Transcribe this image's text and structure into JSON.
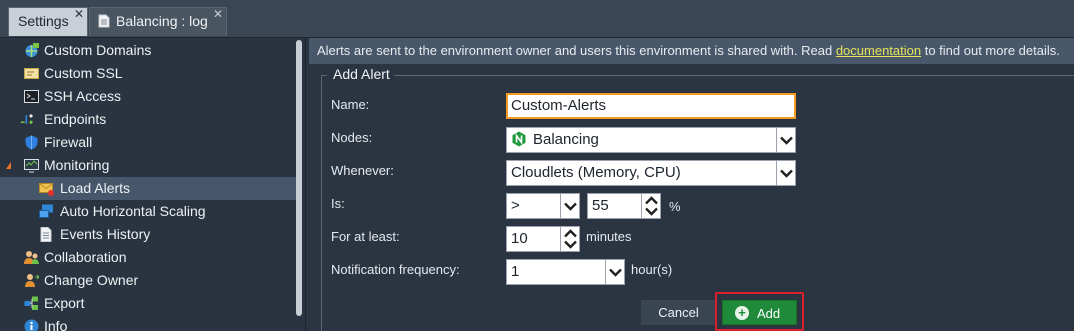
{
  "tabs": [
    {
      "label": "Settings",
      "close": "✕"
    },
    {
      "label": "Balancing : log",
      "close": "✕"
    }
  ],
  "sidebar": {
    "items": [
      {
        "label": "Custom Domains",
        "icon": "globe-icon"
      },
      {
        "label": "Custom SSL",
        "icon": "certificate-icon"
      },
      {
        "label": "SSH Access",
        "icon": "terminal-icon"
      },
      {
        "label": "Endpoints",
        "icon": "endpoints-icon"
      },
      {
        "label": "Firewall",
        "icon": "shield-icon"
      },
      {
        "label": "Monitoring",
        "icon": "monitor-icon",
        "expanded": true
      },
      {
        "label": "Load Alerts",
        "icon": "mail-alert-icon",
        "selected": true
      },
      {
        "label": "Auto Horizontal Scaling",
        "icon": "scaling-icon"
      },
      {
        "label": "Events History",
        "icon": "document-icon"
      },
      {
        "label": "Collaboration",
        "icon": "users-icon"
      },
      {
        "label": "Change Owner",
        "icon": "user-change-icon"
      },
      {
        "label": "Export",
        "icon": "export-icon"
      },
      {
        "label": "Info",
        "icon": "info-icon"
      }
    ]
  },
  "info_bar": {
    "text_before": "Alerts are sent to the environment owner and users this environment is shared with. Read ",
    "link": "documentation",
    "text_after": " to find out more details."
  },
  "form": {
    "legend": "Add Alert",
    "name_label": "Name:",
    "name_value": "Custom-Alerts",
    "nodes_label": "Nodes:",
    "nodes_value": "Balancing",
    "whenever_label": "Whenever:",
    "whenever_value": "Cloudlets (Memory, CPU)",
    "is_label": "Is:",
    "is_operator": ">",
    "is_value": "55",
    "is_unit": "%",
    "for_label": "For at least:",
    "for_value": "10",
    "for_unit": "minutes",
    "freq_label": "Notification frequency:",
    "freq_value": "1",
    "freq_unit": "hour(s)"
  },
  "buttons": {
    "cancel": "Cancel",
    "add": "Add"
  },
  "colors": {
    "accent_orange": "#f29a22",
    "add_green": "#1f8a3a",
    "highlight_red": "#d9202a",
    "link_yellow": "#e8e35a"
  }
}
